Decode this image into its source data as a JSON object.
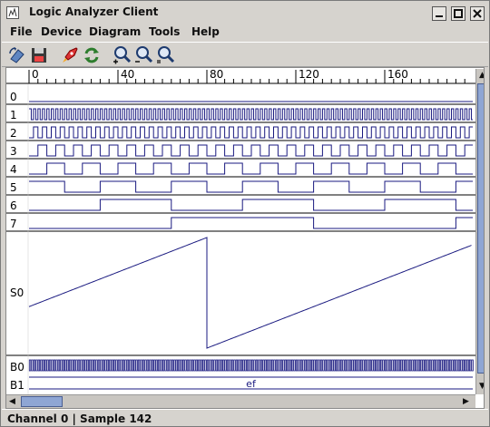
{
  "window": {
    "title": "Logic Analyzer Client"
  },
  "menus": [
    "File",
    "Device",
    "Diagram",
    "Tools",
    "Help"
  ],
  "toolbar": [
    {
      "icon": "capture-icon"
    },
    {
      "icon": "save-disk-icon"
    },
    {
      "icon": "rocket-icon"
    },
    {
      "icon": "refresh-icon"
    },
    {
      "icon": "zoom-in-icon"
    },
    {
      "icon": "zoom-out-icon"
    },
    {
      "icon": "zoom-reset-icon"
    }
  ],
  "diagram": {
    "ruler_labels": [
      "0",
      "40",
      "80",
      "120",
      "160"
    ],
    "ruler_samples": [
      0,
      40,
      80,
      120,
      160
    ],
    "channels": [
      {
        "label": "0",
        "type": "digital",
        "half_period": null,
        "start_high": false
      },
      {
        "label": "1",
        "type": "digital",
        "half_period": 1,
        "start_high": true
      },
      {
        "label": "2",
        "type": "digital",
        "half_period": 2,
        "start_high": false
      },
      {
        "label": "3",
        "type": "digital",
        "half_period": 4,
        "start_high": false
      },
      {
        "label": "4",
        "type": "digital",
        "half_period": 8,
        "start_high": false
      },
      {
        "label": "5",
        "type": "digital",
        "half_period": 16,
        "start_high": true
      },
      {
        "label": "6",
        "type": "digital",
        "half_period": 32,
        "start_high": false
      },
      {
        "label": "7",
        "type": "digital",
        "half_period": 64,
        "start_high": false
      }
    ],
    "analog": {
      "label": "S0",
      "period": 128,
      "offset": 48
    },
    "bus": [
      {
        "label": "B0",
        "value": ""
      },
      {
        "label": "B1",
        "value": "ef"
      }
    ]
  },
  "statusbar": {
    "text": "Channel 0 | Sample 142"
  },
  "colors": {
    "signal": "#1a1a80",
    "selection": "#8fa6d4"
  }
}
